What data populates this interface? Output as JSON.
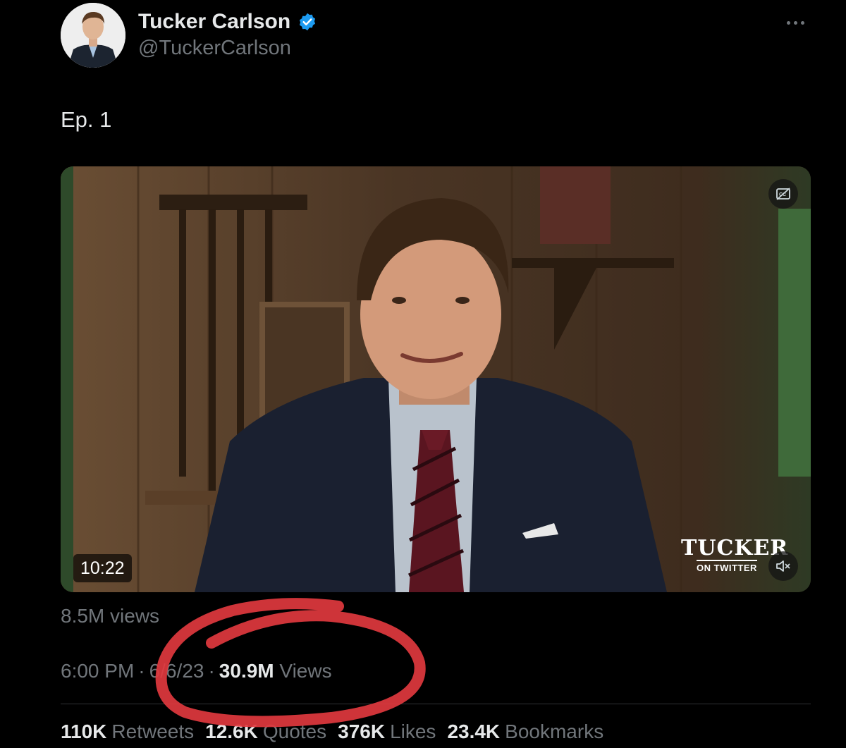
{
  "author": {
    "name": "Tucker Carlson",
    "handle": "@TuckerCarlson",
    "verified": true,
    "verified_color": "#1d9bf0"
  },
  "tweet": {
    "text": "Ep. 1"
  },
  "video": {
    "duration": "10:22",
    "logo_main": "TUCKER",
    "logo_sub": "ON TWITTER",
    "captions_icon": "captions-off-icon",
    "mute_icon": "mute-icon",
    "views_label": "8.5M views"
  },
  "meta": {
    "time": "6:00 PM",
    "sep1": "·",
    "date": "6/6/23",
    "sep2": "·",
    "views_count": "30.9M",
    "views_label": "Views"
  },
  "stats": {
    "retweets_count": "110K",
    "retweets_label": "Retweets",
    "quotes_count": "12.6K",
    "quotes_label": "Quotes",
    "likes_count": "376K",
    "likes_label": "Likes",
    "bookmarks_count": "23.4K",
    "bookmarks_label": "Bookmarks"
  },
  "colors": {
    "background": "#000000",
    "text_primary": "#e7e9ea",
    "text_secondary": "#71767b",
    "annotation_red": "#e0383e"
  }
}
